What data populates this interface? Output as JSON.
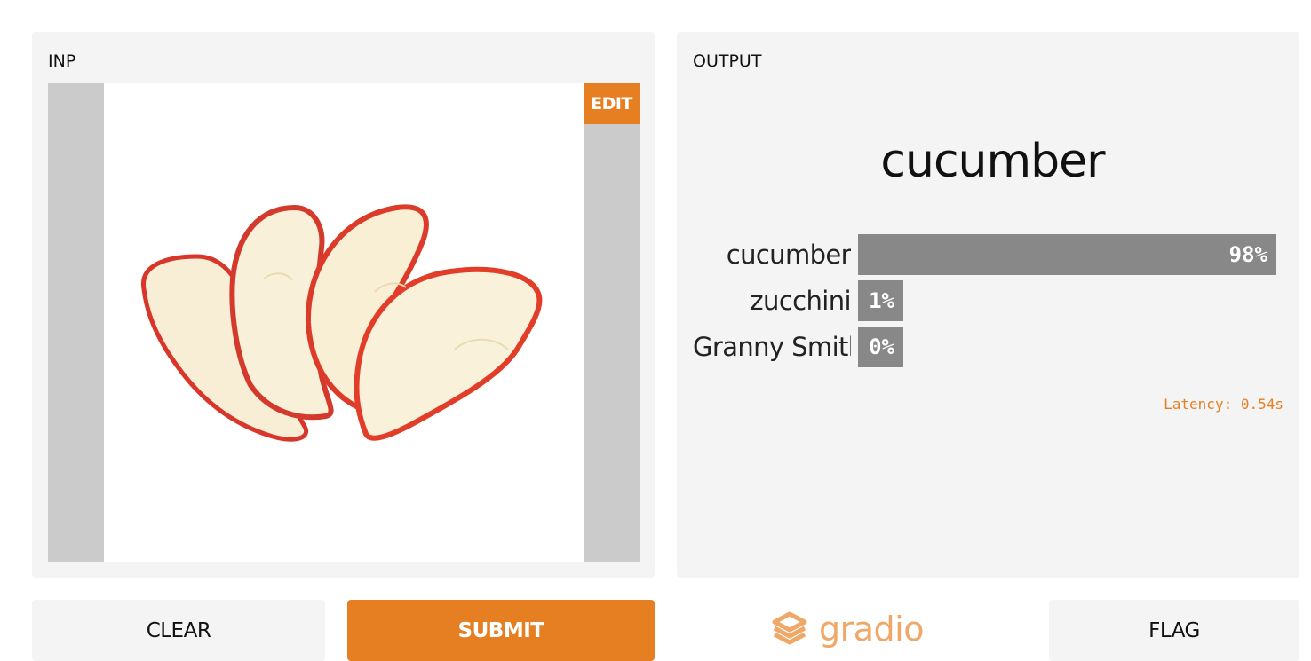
{
  "input": {
    "title": "INP",
    "edit_label": "EDIT",
    "image_alt": "apple slices"
  },
  "output": {
    "title": "OUTPUT",
    "prediction": "cucumber",
    "confidences": [
      {
        "label": "cucumber",
        "value_text": "98%",
        "value": 0.98
      },
      {
        "label": "zucchini",
        "value_text": "1%",
        "value": 0.01
      },
      {
        "label": "Granny Smith",
        "value_text": "0%",
        "value": 0.0
      }
    ],
    "latency": "Latency: 0.54s"
  },
  "actions": {
    "clear_label": "CLEAR",
    "submit_label": "SUBMIT",
    "flag_label": "FLAG"
  },
  "brand": {
    "name": "gradio",
    "icon": "gradio-logo-icon"
  },
  "colors": {
    "accent": "#e67e22",
    "panel_bg": "#f4f4f4",
    "bar": "#888888",
    "brand": "#f0a868"
  }
}
